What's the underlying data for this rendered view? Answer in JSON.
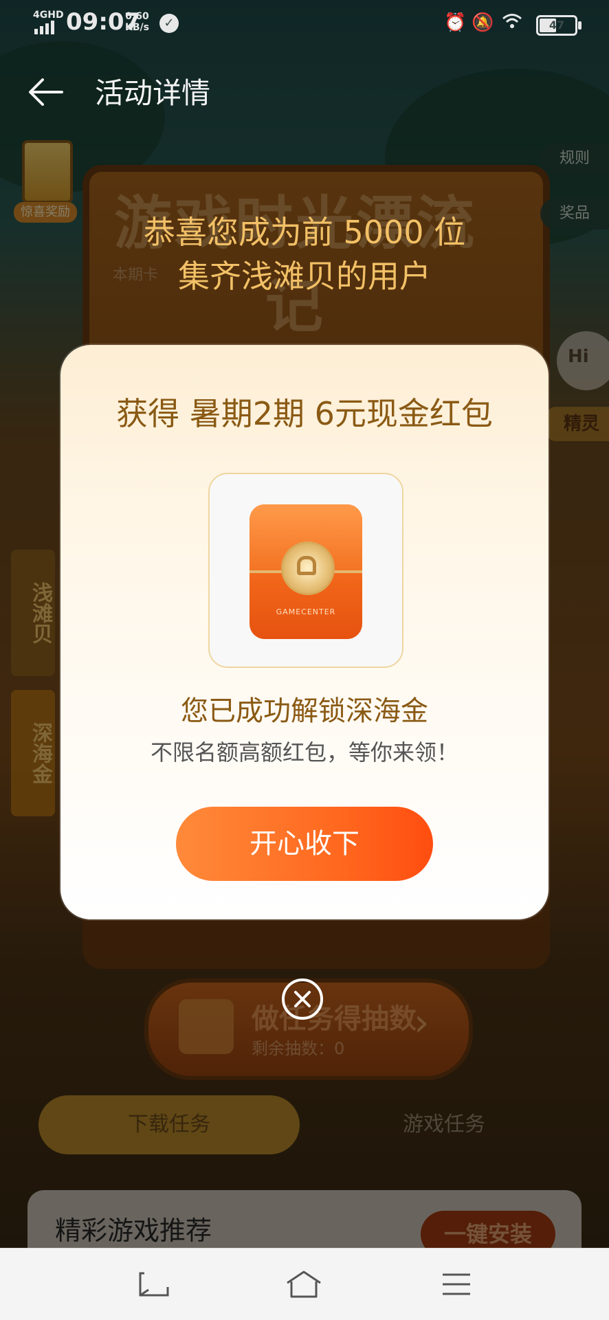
{
  "status_bar": {
    "network": "4GHD",
    "time": "09:07",
    "speed_value": "0.60",
    "speed_unit": "KB/s",
    "battery": "47",
    "battery_fraction": 0.47
  },
  "header": {
    "title": "活动详情"
  },
  "background": {
    "badge_label": "惊喜奖励",
    "title": "游戏时光漂流记",
    "subtitle": "本期卡",
    "rules": "规则",
    "prizes": "奖品",
    "mascot_text": "Hi",
    "jingling": "精灵",
    "tag_shell": "浅滩贝",
    "tag_gold": "深海金",
    "draw_title": "做任务得抽数",
    "draw_remaining": "剩余抽数：0",
    "tab_download": "下载任务",
    "tab_game": "游戏任务",
    "recommend_title": "精彩游戏推荐",
    "install_all": "一键安装"
  },
  "congrats": {
    "line1": "恭喜您成为前 5000 位",
    "line2": "集齐浅滩贝的用户"
  },
  "modal": {
    "title": "获得 暑期2期 6元现金红包",
    "envelope_brand": "GAMECENTER",
    "unlock_text": "您已成功解锁深海金",
    "desc": "不限名额高额红包，等你来领！",
    "accept_button": "开心收下"
  },
  "colors": {
    "accent": "#ff6a20",
    "gold_text": "#8a5a14",
    "congrats_text": "#f2c066"
  },
  "icons": {
    "back": "arrow-left-icon",
    "close": "close-circle-icon",
    "nav_back": "nav-back-icon",
    "nav_home": "nav-home-icon",
    "nav_menu": "nav-menu-icon"
  }
}
